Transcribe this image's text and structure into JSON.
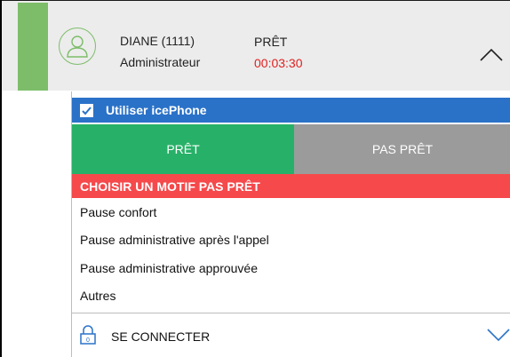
{
  "agent": {
    "name": "DIANE (1111)",
    "role": "Administrateur"
  },
  "status": {
    "label": "PRÊT",
    "timer": "00:03:30"
  },
  "icephone": {
    "label": "Utiliser icePhone",
    "checked": true
  },
  "buttons": {
    "ready": "PRÊT",
    "not_ready": "PAS PRÊT"
  },
  "motif": {
    "header": "CHOISIR UN MOTIF PAS PRÊT",
    "items": [
      "Pause confort",
      "Pause administrative après l'appel",
      "Pause administrative approuvée",
      "Autres"
    ]
  },
  "connect": {
    "label": "SE CONNECTER"
  },
  "colors": {
    "status_green": "#7dbd6a",
    "ready_green": "#27b168",
    "blue": "#2a72c8",
    "red": "#f5494b",
    "grey": "#9b9b9b",
    "timer_red": "#e02020"
  }
}
